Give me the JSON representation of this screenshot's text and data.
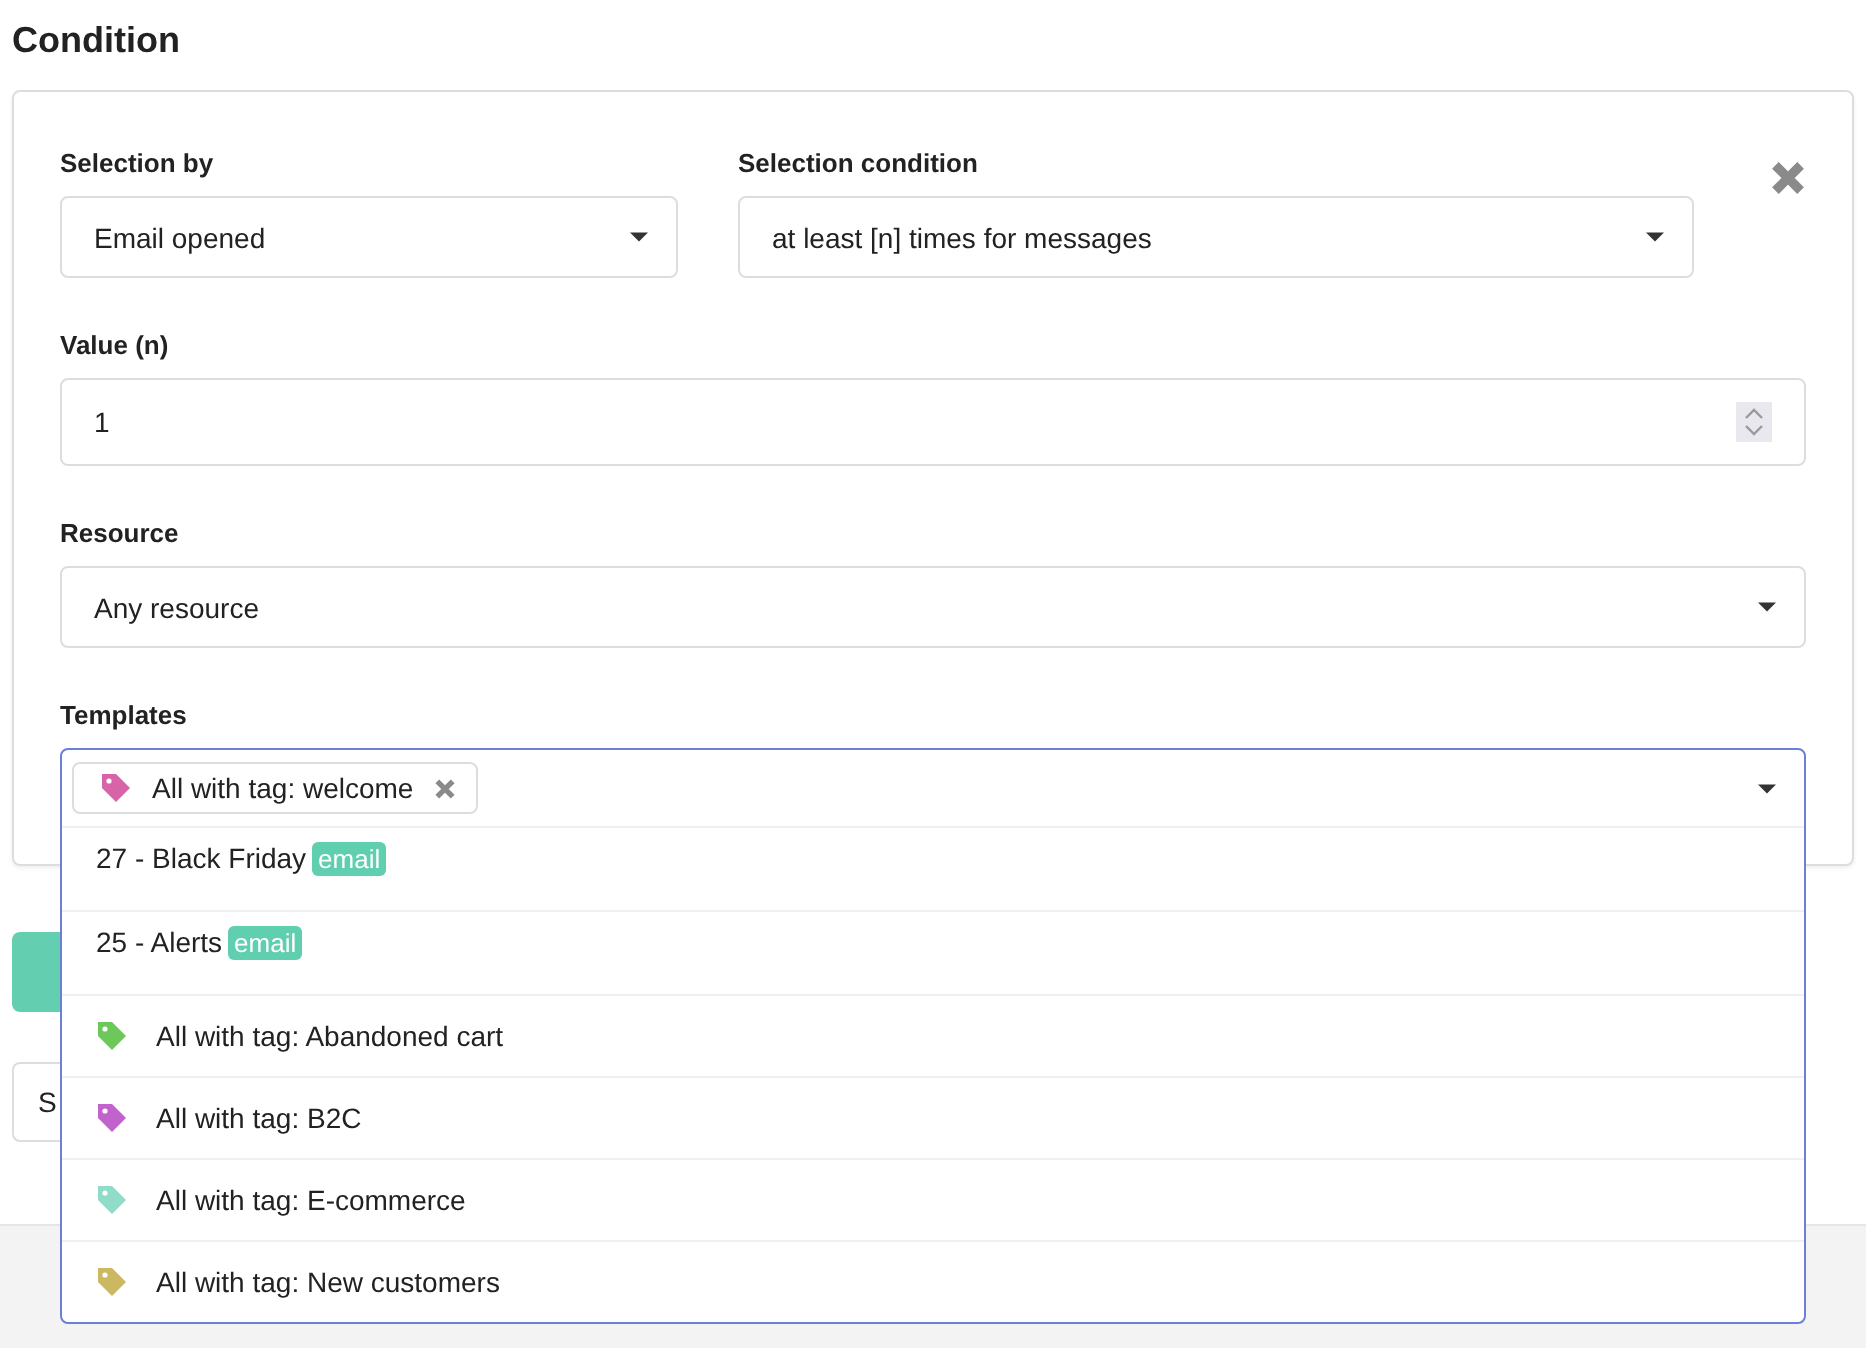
{
  "title": "Condition",
  "selection_by": {
    "label": "Selection by",
    "value": "Email opened"
  },
  "selection_condition": {
    "label": "Selection condition",
    "value": "at least [n] times for messages"
  },
  "value_n": {
    "label": "Value (n)",
    "value": "1"
  },
  "resource": {
    "label": "Resource",
    "value": "Any resource"
  },
  "templates": {
    "label": "Templates",
    "expanded": true,
    "chips": [
      {
        "text": "All with tag: welcome",
        "color": "#d764a8"
      }
    ],
    "options": [
      {
        "kind": "template",
        "text": "27 - Black Friday",
        "badge": "email"
      },
      {
        "kind": "template",
        "text": "25 - Alerts",
        "badge": "email"
      },
      {
        "kind": "tag",
        "text": "All with tag: Abandoned cart",
        "color": "#6cc85a"
      },
      {
        "kind": "tag",
        "text": "All with tag: B2C",
        "color": "#c262cc"
      },
      {
        "kind": "tag",
        "text": "All with tag: E-commerce",
        "color": "#90dcc8"
      },
      {
        "kind": "tag",
        "text": "All with tag: New customers",
        "color": "#ccb860"
      }
    ]
  },
  "hidden_field": {
    "value": "S"
  }
}
